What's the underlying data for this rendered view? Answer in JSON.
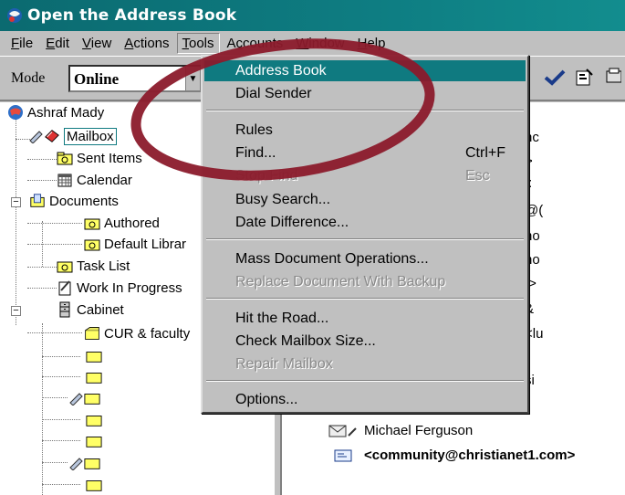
{
  "window": {
    "title": "Open the Address Book"
  },
  "menubar": {
    "items": [
      {
        "label": "File",
        "u": "F"
      },
      {
        "label": "Edit",
        "u": "E"
      },
      {
        "label": "View",
        "u": "V"
      },
      {
        "label": "Actions",
        "u": "A"
      },
      {
        "label": "Tools",
        "u": "T"
      },
      {
        "label": "Accounts",
        "u": "c"
      },
      {
        "label": "Window",
        "u": "W"
      },
      {
        "label": "Help",
        "u": "H"
      }
    ]
  },
  "toolbar": {
    "mode_label": "Mode",
    "mode_value": "Online"
  },
  "tree": {
    "root": "Ashraf Mady",
    "mailbox": "Mailbox",
    "sent_items": "Sent Items",
    "calendar": "Calendar",
    "documents": "Documents",
    "authored": "Authored",
    "default_library": "Default Librar",
    "task_list": "Task List",
    "work_in_progress": "Work In Progress",
    "cabinet": "Cabinet",
    "cur_faculty": "CUR & faculty"
  },
  "right_pane": {
    "fragments": [
      "nc",
      ">",
      "t:",
      "@(",
      "no",
      "no",
      "t>",
      "&",
      "<lu",
      "l'",
      "si"
    ],
    "sender_name": "Michael Ferguson",
    "sender_email": "<community@christianet1.com>"
  },
  "tools_menu": {
    "address_book": "Address Book",
    "dial_sender": "Dial Sender",
    "rules": "Rules",
    "find": "Find...",
    "find_shortcut": "Ctrl+F",
    "stop_find": "Stop Find",
    "stop_find_shortcut": "Esc",
    "busy_search": "Busy Search...",
    "date_difference": "Date Difference...",
    "mass_doc_ops": "Mass Document Operations...",
    "replace_doc": "Replace Document With Backup",
    "hit_the_road": "Hit the Road...",
    "check_mailbox": "Check Mailbox Size...",
    "repair_mailbox": "Repair Mailbox",
    "options": "Options..."
  },
  "colors": {
    "title_bar": "#0e7d82",
    "highlight": "#0f7a80",
    "annotation_ellipse": "#8b1a2b"
  }
}
